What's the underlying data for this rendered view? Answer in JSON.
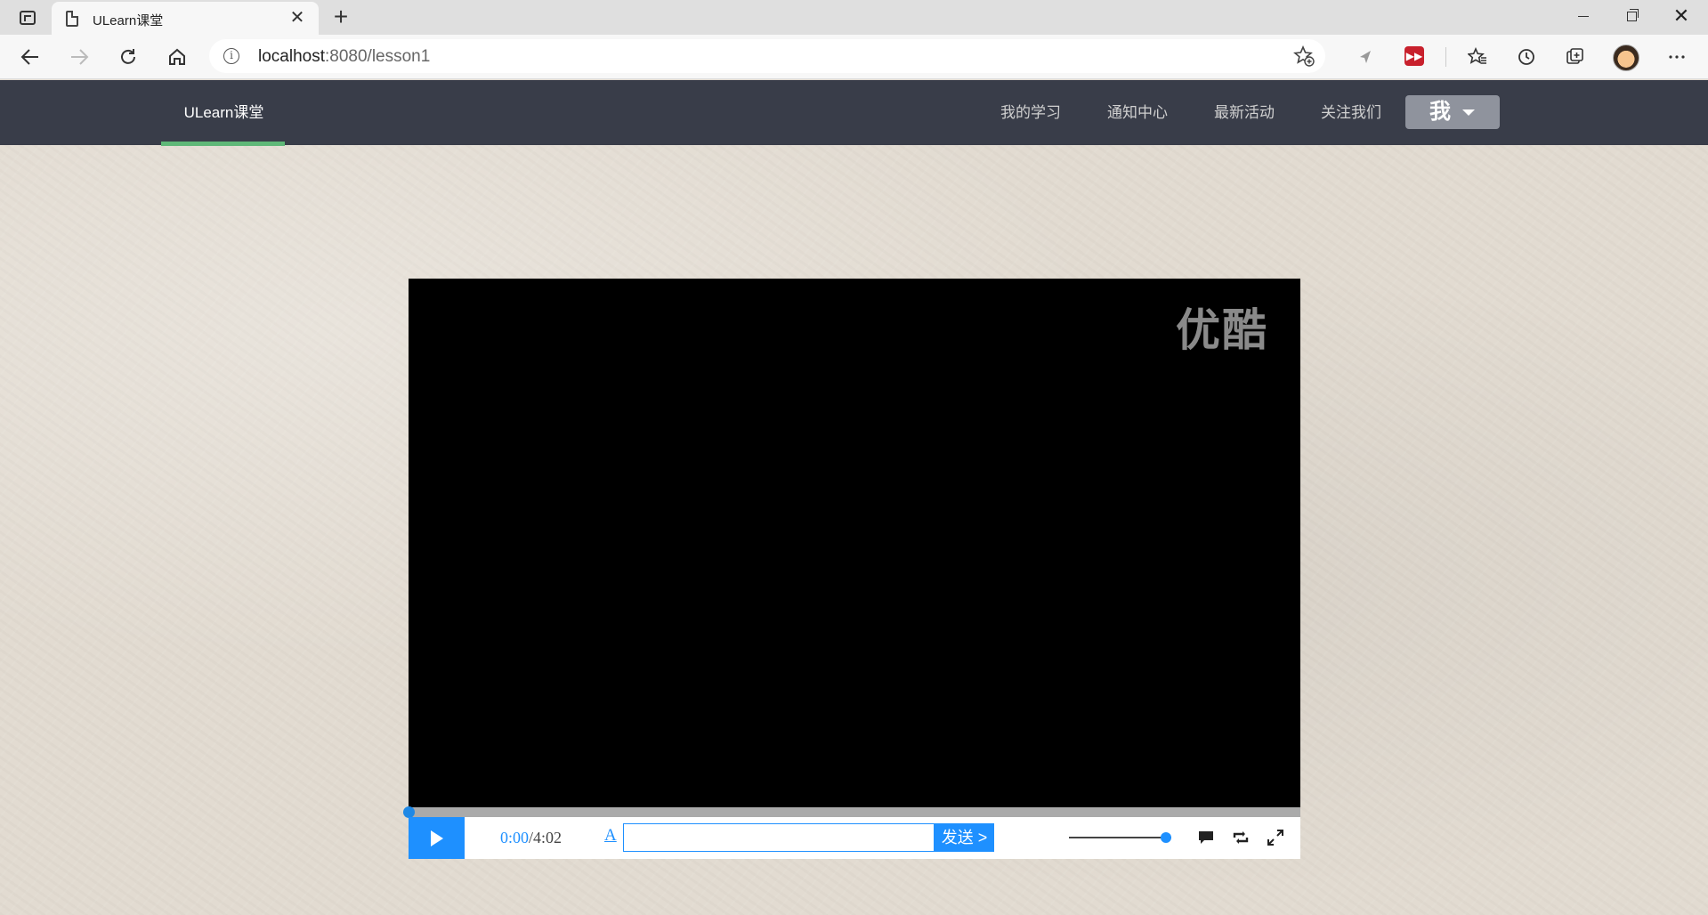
{
  "browser": {
    "tab_title": "ULearn课堂",
    "tab_close": "✕",
    "new_tab": "+",
    "url_host": "localhost",
    "url_rest": ":8080/lesson1",
    "win_close": "✕"
  },
  "navbar": {
    "brand": "ULearn课堂",
    "items": [
      {
        "label": "我的学习"
      },
      {
        "label": "通知中心"
      },
      {
        "label": "最新活动"
      },
      {
        "label": "关注我们"
      }
    ],
    "me_label": "我"
  },
  "player": {
    "watermark": "优酷",
    "current_time": "0:00",
    "total_time": "/4:02",
    "progress": 0,
    "font_button": "A",
    "danmu_placeholder": "",
    "send_label": "发送 >",
    "volume": 0.95
  },
  "colors": {
    "navbar_bg": "#393d49",
    "brand_underline": "#5fb878",
    "accent_blue": "#1e90ff"
  }
}
